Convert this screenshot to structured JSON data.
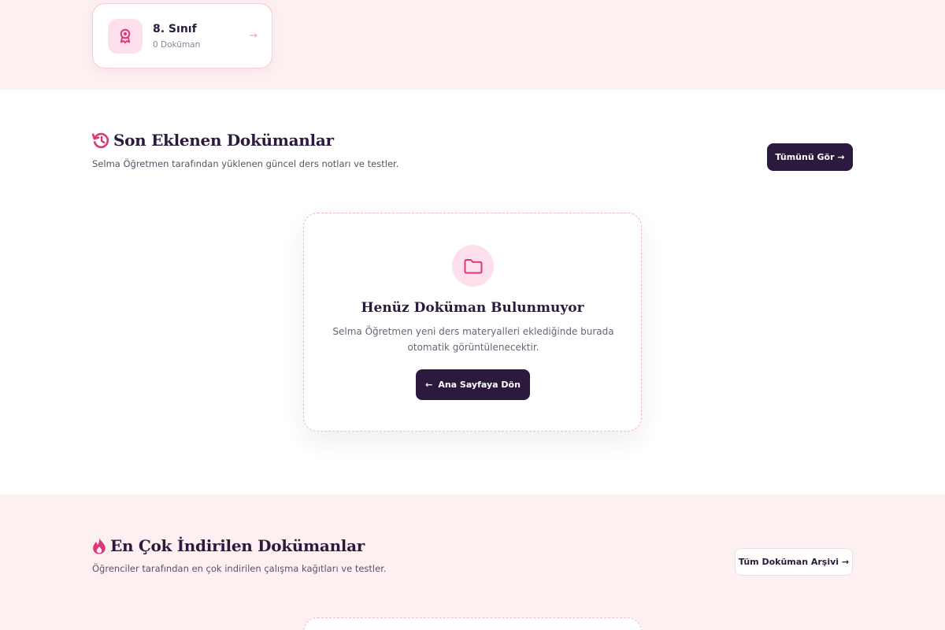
{
  "grade_card": {
    "title": "8. Sınıf",
    "subtitle": "0 Doküman",
    "icon": "award-icon",
    "arrow": "→"
  },
  "recent_section": {
    "title": "Son Eklenen Dokümanlar",
    "subtitle": "Selma Öğretmen tarafından yüklenen güncel ders notları ve testler.",
    "icon": "history-icon",
    "button_label": "Tümünü Gör →"
  },
  "empty_state": {
    "icon": "folder-icon",
    "title": "Henüz Doküman Bulunmuyor",
    "text": "Selma Öğretmen yeni ders materyalleri eklediğinde burada otomatik görüntülenecektir.",
    "button_arrow": "←",
    "button_label": "Ana Sayfaya Dön"
  },
  "popular_section": {
    "title": "En Çok İndirilen Dokümanlar",
    "subtitle": "Öğrenciler tarafından en çok indirilen çalışma kağıtları ve testler.",
    "icon": "fire-icon",
    "button_label": "Tüm Doküman Arşivi →"
  },
  "colors": {
    "accent_pink": "#e0357a",
    "dark": "#2b1a3d",
    "band_bg": "#fdf0f0",
    "icon_bg": "#fde0ec"
  }
}
